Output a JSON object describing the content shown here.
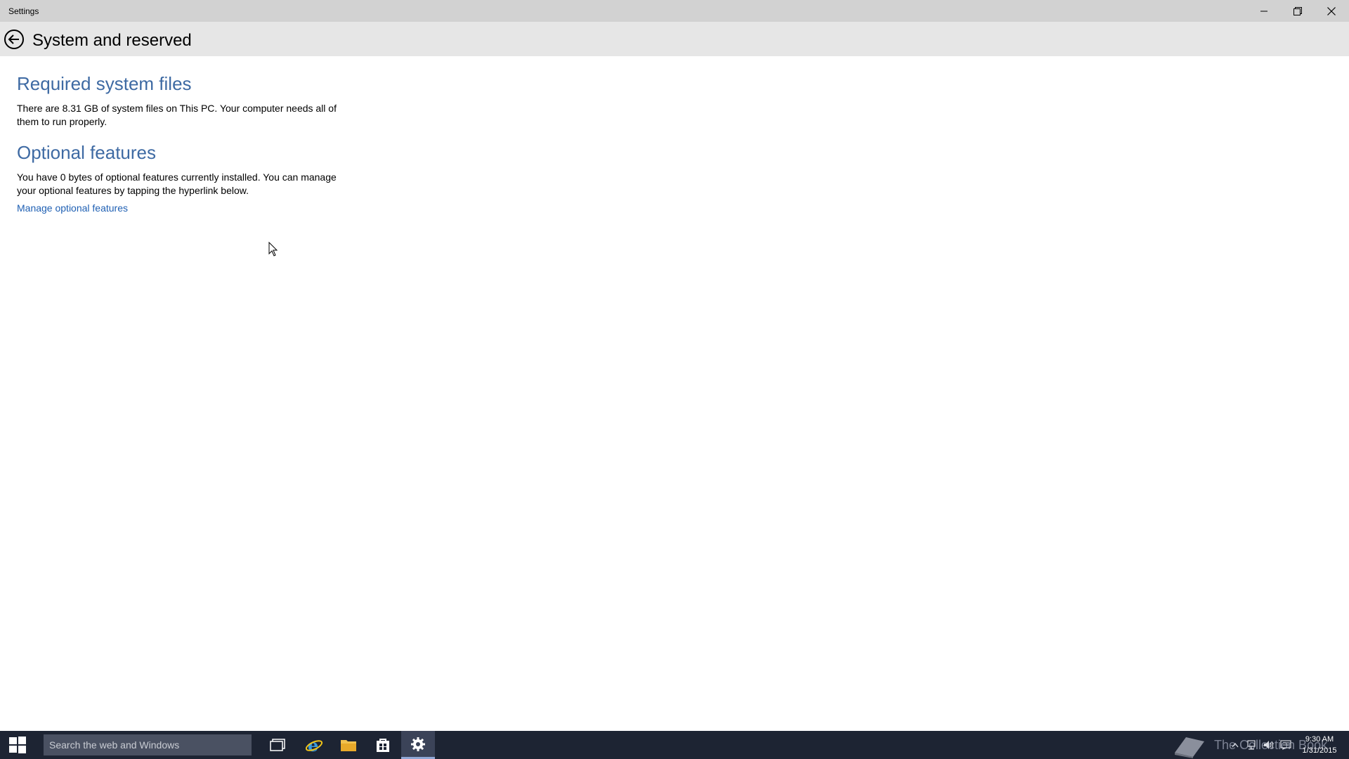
{
  "window": {
    "title": "Settings"
  },
  "header": {
    "title": "System and reserved"
  },
  "required": {
    "heading": "Required system files",
    "text": "There are 8.31 GB of system files on This PC. Your computer needs all of them to run properly."
  },
  "optional": {
    "heading": "Optional features",
    "text": "You have 0 bytes of optional features currently installed. You can manage your optional features by tapping the hyperlink below.",
    "link": "Manage optional features"
  },
  "taskbar": {
    "search_placeholder": "Search the web and Windows",
    "apps": [
      "task-view",
      "internet-explorer",
      "file-explorer",
      "store",
      "settings"
    ],
    "active_app": "settings",
    "watermark": "The Collection Book",
    "clock": {
      "time": "9:30 AM",
      "date": "1/31/2015"
    }
  },
  "colors": {
    "heading": "#3e6aa3",
    "link": "#1e5fb3",
    "titlebar": "#d2d2d2",
    "header": "#e6e6e6",
    "taskbar": "#1d2433"
  }
}
